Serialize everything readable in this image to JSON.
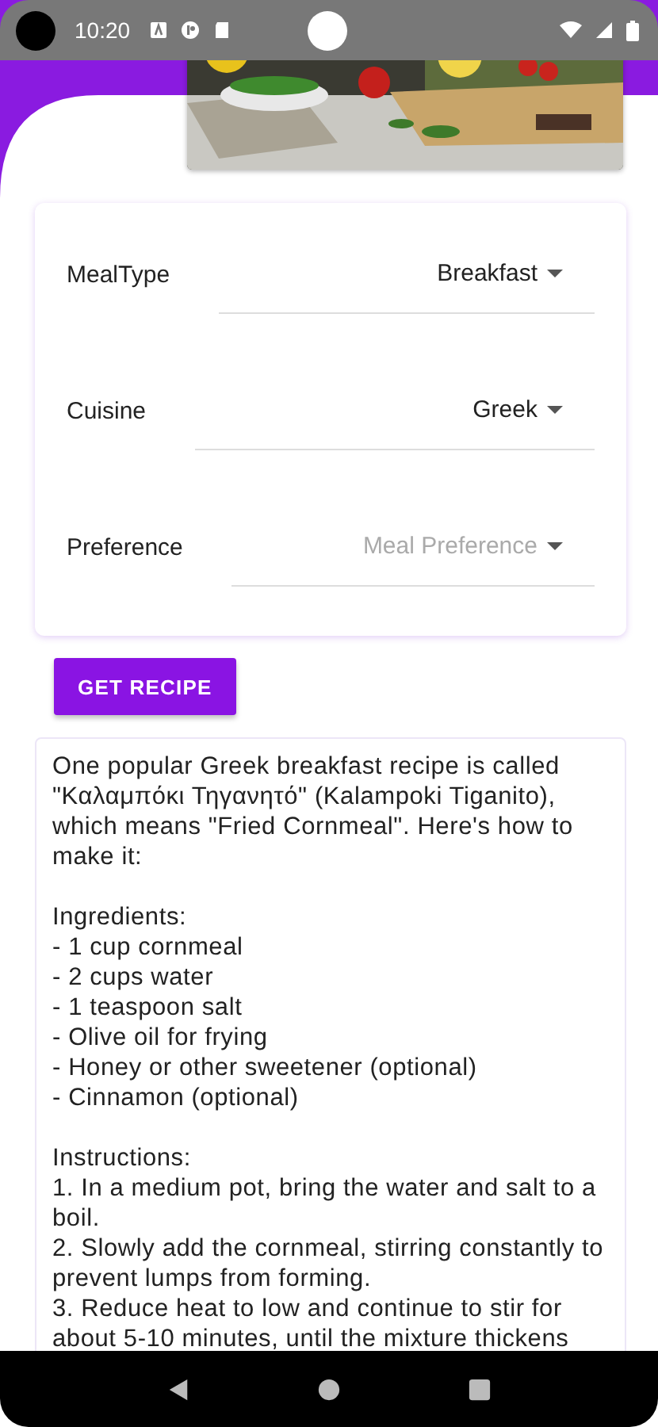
{
  "status_bar": {
    "time": "10:20"
  },
  "form": {
    "fields": [
      {
        "label": "MealType",
        "value": "Breakfast"
      },
      {
        "label": "Cuisine",
        "value": "Greek"
      },
      {
        "label": "Preference",
        "placeholder": "Meal Preference"
      }
    ]
  },
  "get_recipe_button": {
    "label": "GET RECIPE"
  },
  "recipe": {
    "text": "One popular Greek breakfast recipe is called \"Καλαμπόκι Τηγανητό\" (Kalampoki Tiganito), which means \"Fried Cornmeal\". Here's how to make it:\n\nIngredients:\n- 1 cup cornmeal\n- 2 cups water\n- 1 teaspoon salt\n- Olive oil for frying\n- Honey or other sweetener (optional)\n- Cinnamon (optional)\n\nInstructions:\n1. In a medium pot, bring the water and salt to a boil.\n2. Slowly add the cornmeal, stirring constantly to prevent lumps from forming.\n3. Reduce heat to low and continue to stir for about 5-10 minutes, until the mixture thickens"
  }
}
